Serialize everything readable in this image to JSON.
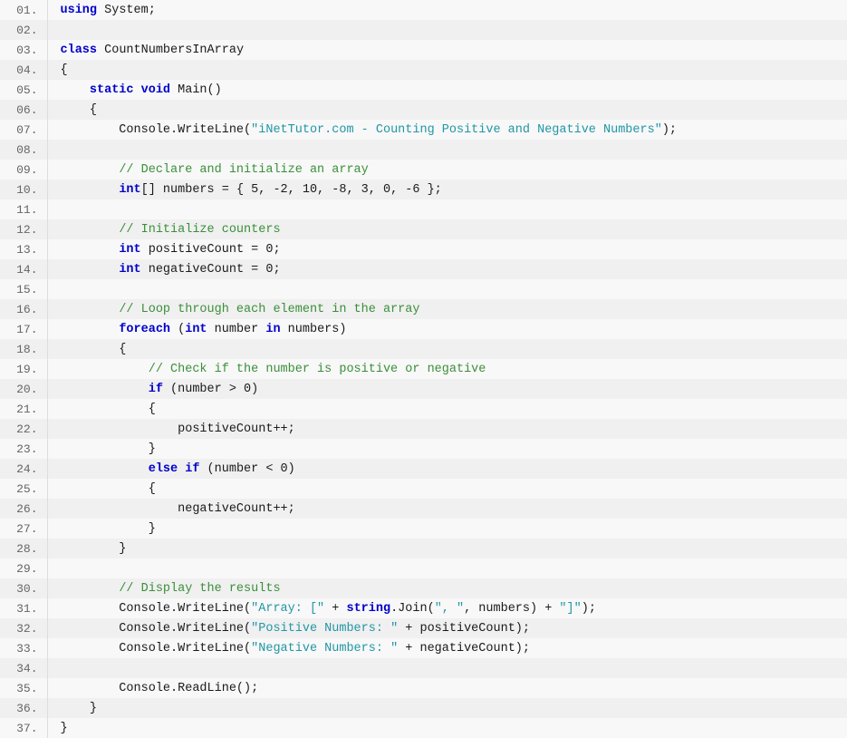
{
  "lines": [
    {
      "num": "01.",
      "tokens": [
        {
          "t": "kw",
          "v": "using"
        },
        {
          "t": "plain",
          "v": " System;"
        }
      ]
    },
    {
      "num": "02.",
      "tokens": []
    },
    {
      "num": "03.",
      "tokens": [
        {
          "t": "kw",
          "v": "class"
        },
        {
          "t": "plain",
          "v": " CountNumbersInArray"
        }
      ]
    },
    {
      "num": "04.",
      "tokens": [
        {
          "t": "plain",
          "v": "{"
        }
      ]
    },
    {
      "num": "05.",
      "tokens": [
        {
          "t": "plain",
          "v": "    "
        },
        {
          "t": "kw",
          "v": "static"
        },
        {
          "t": "plain",
          "v": " "
        },
        {
          "t": "kw",
          "v": "void"
        },
        {
          "t": "plain",
          "v": " Main()"
        }
      ]
    },
    {
      "num": "06.",
      "tokens": [
        {
          "t": "plain",
          "v": "    {"
        }
      ]
    },
    {
      "num": "07.",
      "tokens": [
        {
          "t": "plain",
          "v": "        Console.WriteLine("
        },
        {
          "t": "str",
          "v": "\"iNetTutor.com - Counting Positive and Negative Numbers\""
        },
        {
          "t": "plain",
          "v": ");"
        }
      ]
    },
    {
      "num": "08.",
      "tokens": []
    },
    {
      "num": "09.",
      "tokens": [
        {
          "t": "plain",
          "v": "        "
        },
        {
          "t": "cmt",
          "v": "// Declare and initialize an array"
        }
      ]
    },
    {
      "num": "10.",
      "tokens": [
        {
          "t": "plain",
          "v": "        "
        },
        {
          "t": "kw",
          "v": "int"
        },
        {
          "t": "plain",
          "v": "[] numbers = { 5, -2, 10, -8, 3, 0, -6 };"
        }
      ]
    },
    {
      "num": "11.",
      "tokens": []
    },
    {
      "num": "12.",
      "tokens": [
        {
          "t": "plain",
          "v": "        "
        },
        {
          "t": "cmt",
          "v": "// Initialize counters"
        }
      ]
    },
    {
      "num": "13.",
      "tokens": [
        {
          "t": "plain",
          "v": "        "
        },
        {
          "t": "kw",
          "v": "int"
        },
        {
          "t": "plain",
          "v": " positiveCount = 0;"
        }
      ]
    },
    {
      "num": "14.",
      "tokens": [
        {
          "t": "plain",
          "v": "        "
        },
        {
          "t": "kw",
          "v": "int"
        },
        {
          "t": "plain",
          "v": " negativeCount = 0;"
        }
      ]
    },
    {
      "num": "15.",
      "tokens": []
    },
    {
      "num": "16.",
      "tokens": [
        {
          "t": "plain",
          "v": "        "
        },
        {
          "t": "cmt",
          "v": "// Loop through each element in the array"
        }
      ]
    },
    {
      "num": "17.",
      "tokens": [
        {
          "t": "plain",
          "v": "        "
        },
        {
          "t": "kw",
          "v": "foreach"
        },
        {
          "t": "plain",
          "v": " ("
        },
        {
          "t": "kw",
          "v": "int"
        },
        {
          "t": "plain",
          "v": " number "
        },
        {
          "t": "kw",
          "v": "in"
        },
        {
          "t": "plain",
          "v": " numbers)"
        }
      ]
    },
    {
      "num": "18.",
      "tokens": [
        {
          "t": "plain",
          "v": "        {"
        }
      ]
    },
    {
      "num": "19.",
      "tokens": [
        {
          "t": "plain",
          "v": "            "
        },
        {
          "t": "cmt",
          "v": "// Check if the number is positive or negative"
        }
      ]
    },
    {
      "num": "20.",
      "tokens": [
        {
          "t": "plain",
          "v": "            "
        },
        {
          "t": "kw",
          "v": "if"
        },
        {
          "t": "plain",
          "v": " (number > 0)"
        }
      ]
    },
    {
      "num": "21.",
      "tokens": [
        {
          "t": "plain",
          "v": "            {"
        }
      ]
    },
    {
      "num": "22.",
      "tokens": [
        {
          "t": "plain",
          "v": "                positiveCount++;"
        }
      ]
    },
    {
      "num": "23.",
      "tokens": [
        {
          "t": "plain",
          "v": "            }"
        }
      ]
    },
    {
      "num": "24.",
      "tokens": [
        {
          "t": "plain",
          "v": "            "
        },
        {
          "t": "kw",
          "v": "else"
        },
        {
          "t": "plain",
          "v": " "
        },
        {
          "t": "kw",
          "v": "if"
        },
        {
          "t": "plain",
          "v": " (number < 0)"
        }
      ]
    },
    {
      "num": "25.",
      "tokens": [
        {
          "t": "plain",
          "v": "            {"
        }
      ]
    },
    {
      "num": "26.",
      "tokens": [
        {
          "t": "plain",
          "v": "                negativeCount++;"
        }
      ]
    },
    {
      "num": "27.",
      "tokens": [
        {
          "t": "plain",
          "v": "            }"
        }
      ]
    },
    {
      "num": "28.",
      "tokens": [
        {
          "t": "plain",
          "v": "        }"
        }
      ]
    },
    {
      "num": "29.",
      "tokens": []
    },
    {
      "num": "30.",
      "tokens": [
        {
          "t": "plain",
          "v": "        "
        },
        {
          "t": "cmt",
          "v": "// Display the results"
        }
      ]
    },
    {
      "num": "31.",
      "tokens": [
        {
          "t": "plain",
          "v": "        Console.WriteLine("
        },
        {
          "t": "str",
          "v": "\"Array: [\""
        },
        {
          "t": "plain",
          "v": " + "
        },
        {
          "t": "kw",
          "v": "string"
        },
        {
          "t": "plain",
          "v": ".Join("
        },
        {
          "t": "str",
          "v": "\", \""
        },
        {
          "t": "plain",
          "v": ", numbers) + "
        },
        {
          "t": "str",
          "v": "\"]\""
        },
        {
          "t": "plain",
          "v": ");"
        }
      ]
    },
    {
      "num": "32.",
      "tokens": [
        {
          "t": "plain",
          "v": "        Console.WriteLine("
        },
        {
          "t": "str",
          "v": "\"Positive Numbers: \""
        },
        {
          "t": "plain",
          "v": " + positiveCount);"
        }
      ]
    },
    {
      "num": "33.",
      "tokens": [
        {
          "t": "plain",
          "v": "        Console.WriteLine("
        },
        {
          "t": "str",
          "v": "\"Negative Numbers: \""
        },
        {
          "t": "plain",
          "v": " + negativeCount);"
        }
      ]
    },
    {
      "num": "34.",
      "tokens": []
    },
    {
      "num": "35.",
      "tokens": [
        {
          "t": "plain",
          "v": "        Console.ReadLine();"
        }
      ]
    },
    {
      "num": "36.",
      "tokens": [
        {
          "t": "plain",
          "v": "    }"
        }
      ]
    },
    {
      "num": "37.",
      "tokens": [
        {
          "t": "plain",
          "v": "}"
        }
      ]
    }
  ]
}
